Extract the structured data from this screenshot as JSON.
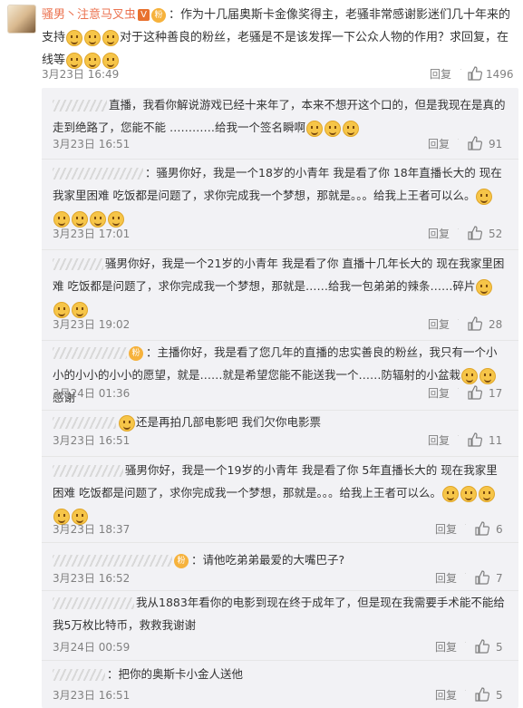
{
  "main_comment": {
    "author": "骚男丶注意马叉虫",
    "text_part1": "：作为十几届奥斯卡金像奖得主，老骚非常感谢影迷们几十年来的支持",
    "text_part2": "对于这种善良的粉丝，老骚是不是该发挥一下公众人物的作用？求回复，在线等",
    "time": "3月23日 16:49",
    "reply_label": "回复",
    "likes": "1496"
  },
  "replies": [
    {
      "text_a": "直播，我看你解说游戏已经十来年了，本来不想开这个口的，但是我现在是真的走到绝路了，您能不能 …………给我一个签名瞬啊",
      "time": "3月23日 16:51",
      "reply_label": "回复",
      "likes": "91"
    },
    {
      "text_a": "：骚男你好，我是一个18岁的小青年  我是看了你 18年直播长大的  现在我家里困难  吃饭都是问题了，求你完成我一个梦想，那就是。。。给我上王者可以么。",
      "time": "3月23日 17:01",
      "reply_label": "回复",
      "likes": "52"
    },
    {
      "text_a": "骚男你好，我是一个21岁的小青年  我是看了你 直播十几年长大的  现在我家里困难  吃饭都是问题了，求你完成我一个梦想，那就是……给我一包弟弟的辣条……碎片",
      "time": "3月23日 19:02",
      "reply_label": "回复",
      "likes": "28"
    },
    {
      "text_a": "：主播你好，我是看了您几年的直播的忠实善良的粉丝，我只有一个小小的小小的小小的愿望，就是……就是希望您能不能送我一个……防辐射的小盆栽",
      "text_b": "感谢",
      "time": "3月24日 01:36",
      "reply_label": "回复",
      "likes": "17"
    },
    {
      "text_a": "还是再拍几部电影吧  我们欠你电影票",
      "time": "3月23日 16:51",
      "reply_label": "回复",
      "likes": "11"
    },
    {
      "text_a": "骚男你好，我是一个19岁的小青年  我是看了你 5年直播长大的  现在我家里困难  吃饭都是问题了，求你完成我一个梦想，那就是。。。给我上王者可以么。",
      "time": "3月23日 18:37",
      "reply_label": "回复",
      "likes": "6"
    },
    {
      "text_a": "：请他吃弟弟最爱的大嘴巴子?",
      "time": "3月23日 16:52",
      "reply_label": "回复",
      "likes": "7"
    },
    {
      "text_a": "我从1883年看你的电影到现在终于成年了，但是现在我需要手术能不能给我5万枚比特币，救救我谢谢",
      "time": "3月24日 00:59",
      "reply_label": "回复",
      "likes": "5"
    },
    {
      "text_a": "：把你的奥斯卡小金人送他",
      "time": "3月23日 16:51",
      "reply_label": "回复",
      "likes": "5"
    }
  ],
  "icons": {
    "like": "thumbs-up-icon",
    "verified": "verified-v-icon",
    "fan": "fan-level-icon",
    "emoji": "laughing-emoji-icon"
  },
  "colors": {
    "username": "#eb7350",
    "meta": "#808080",
    "panel": "#f2f2f5"
  }
}
